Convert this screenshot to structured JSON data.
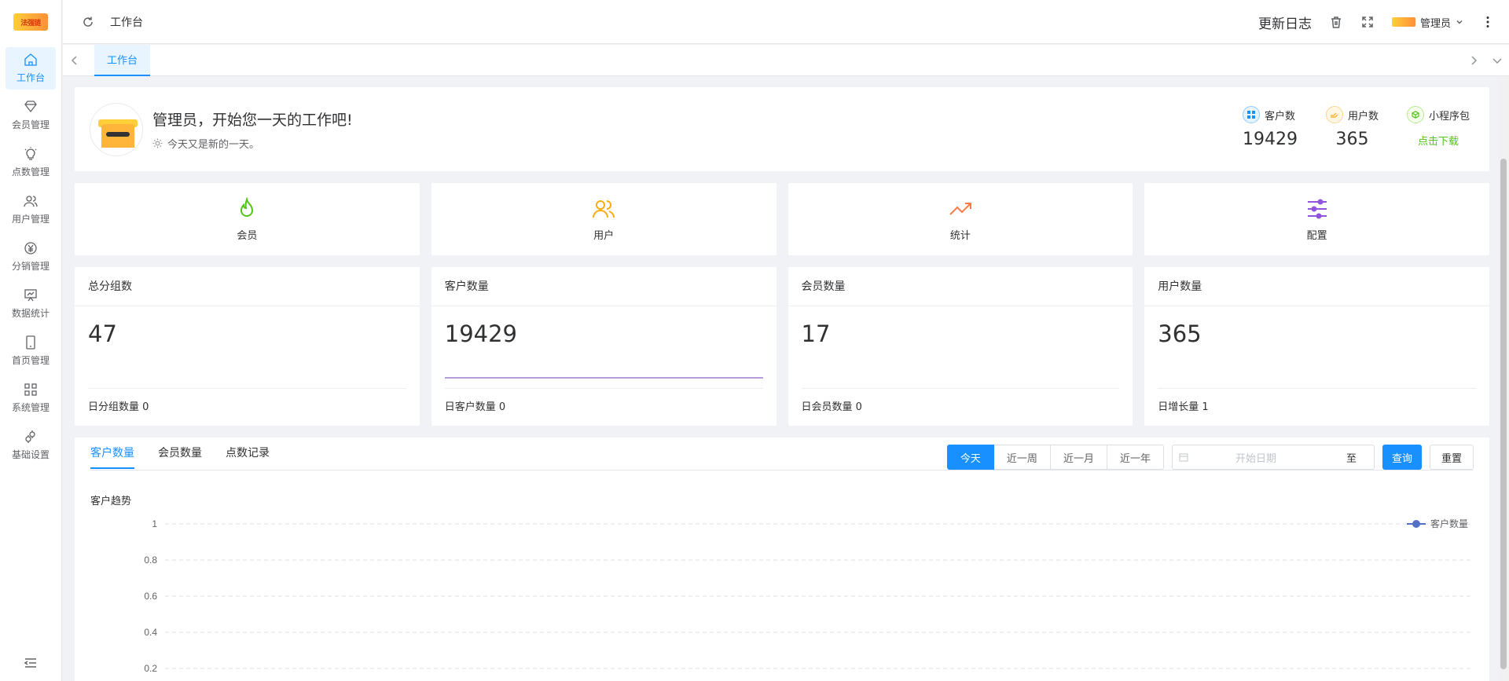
{
  "app": {
    "logo_text": "法强链"
  },
  "sidebar": {
    "items": [
      {
        "label": "工作台",
        "icon": "home-icon"
      },
      {
        "label": "会员管理",
        "icon": "diamond-icon"
      },
      {
        "label": "点数管理",
        "icon": "bulb-icon"
      },
      {
        "label": "用户管理",
        "icon": "users-icon"
      },
      {
        "label": "分销管理",
        "icon": "yen-icon"
      },
      {
        "label": "数据统计",
        "icon": "chart-board-icon"
      },
      {
        "label": "首页管理",
        "icon": "mobile-icon"
      },
      {
        "label": "系统管理",
        "icon": "grid-icon"
      },
      {
        "label": "基础设置",
        "icon": "gears-icon"
      }
    ]
  },
  "header": {
    "breadcrumb": "工作台",
    "update_log": "更新日志",
    "user_name": "管理员"
  },
  "tabs": {
    "current": "工作台"
  },
  "welcome": {
    "title": "管理员，开始您一天的工作吧!",
    "subtitle": "今天又是新的一天。",
    "stats": [
      {
        "label": "客户数",
        "value": "19429",
        "color": "#1890ff"
      },
      {
        "label": "用户数",
        "value": "365",
        "color": "#faad14"
      },
      {
        "label": "小程序包",
        "link": "点击下载",
        "color": "#52c41a"
      }
    ]
  },
  "quick": [
    {
      "label": "会员",
      "icon": "fire-icon",
      "color": "#52c41a"
    },
    {
      "label": "用户",
      "icon": "users-icon",
      "color": "#faad14"
    },
    {
      "label": "统计",
      "icon": "trend-icon",
      "color": "#ff7a45"
    },
    {
      "label": "配置",
      "icon": "sliders-icon",
      "color": "#9254de"
    }
  ],
  "numbers": [
    {
      "title": "总分组数",
      "value": "47",
      "foot": "日分组数量 0"
    },
    {
      "title": "客户数量",
      "value": "19429",
      "foot": "日客户数量 0"
    },
    {
      "title": "会员数量",
      "value": "17",
      "foot": "日会员数量 0"
    },
    {
      "title": "用户数量",
      "value": "365",
      "foot": "日增长量 1"
    }
  ],
  "chart_section": {
    "tabs": [
      "客户数量",
      "会员数量",
      "点数记录"
    ],
    "ranges": [
      "今天",
      "近一周",
      "近一月",
      "近一年"
    ],
    "date_placeholder": "开始日期",
    "date_sep": "至",
    "query_label": "查询",
    "reset_label": "重置",
    "chart_title": "客户趋势"
  },
  "chart_data": {
    "type": "line",
    "title": "客户趋势",
    "series": [
      {
        "name": "客户数量",
        "values": []
      }
    ],
    "yticks": [
      "1",
      "0.8",
      "0.6",
      "0.4",
      "0.2"
    ],
    "ylim": [
      0,
      1
    ],
    "grid": true,
    "legend": "top-right",
    "color": "#5470c6"
  }
}
